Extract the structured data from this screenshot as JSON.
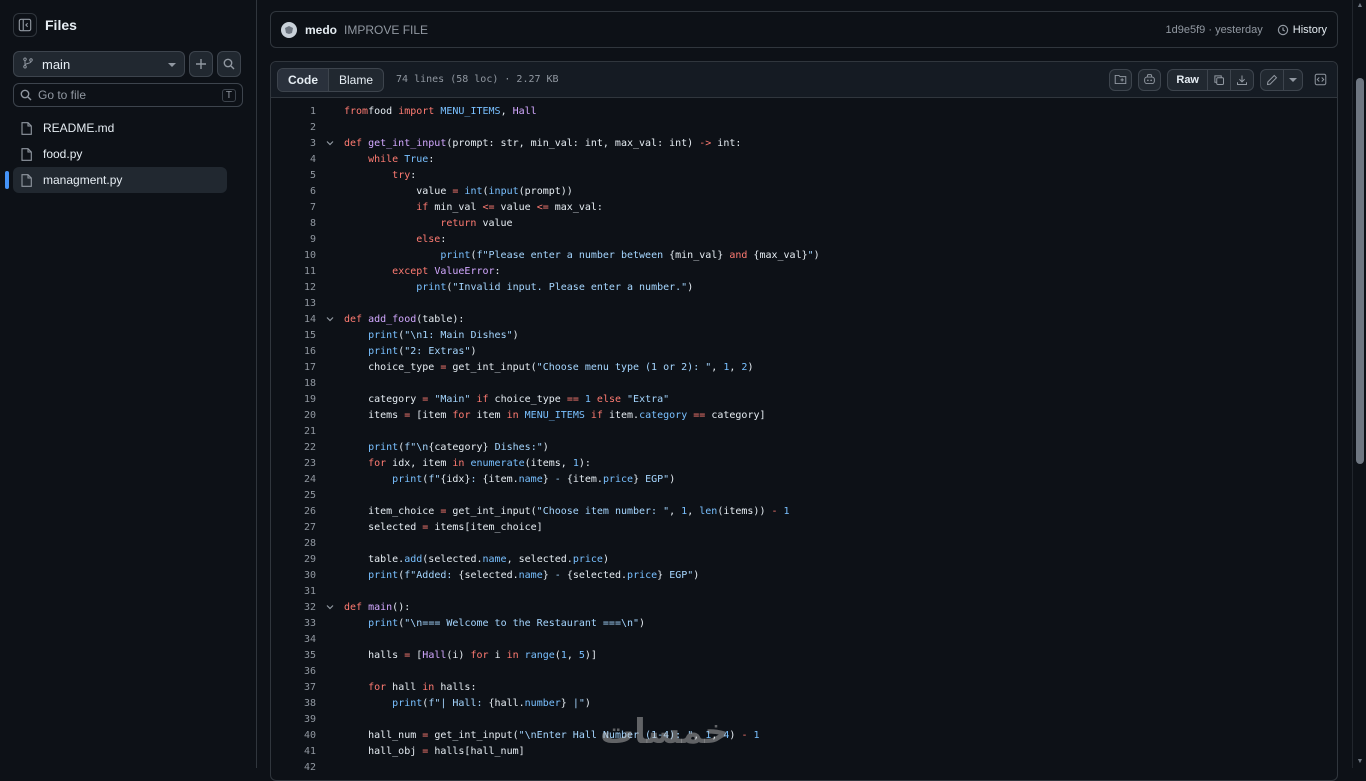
{
  "sidebar": {
    "title": "Files",
    "branch": "main",
    "search_placeholder": "Go to file",
    "search_shortcut": "T",
    "files": [
      {
        "name": "README.md",
        "active": false
      },
      {
        "name": "food.py",
        "active": false
      },
      {
        "name": "managment.py",
        "active": true
      }
    ]
  },
  "commit": {
    "author": "medo",
    "message": "IMPROVE FILE",
    "meta": "1d9e5f9 · yesterday",
    "history_label": "History"
  },
  "toolbar": {
    "code_tab": "Code",
    "blame_tab": "Blame",
    "file_info": "74 lines (58 loc) · 2.27 KB",
    "raw_label": "Raw"
  },
  "code_lines": [
    {
      "n": "1",
      "fold": false,
      "tokens": [
        [
          "k",
          "from"
        ],
        [
          "",
          "food "
        ],
        [
          "k",
          "import"
        ],
        [
          "c",
          " MENU_ITEMS"
        ],
        [
          "",
          ", "
        ],
        [
          "f",
          "Hall"
        ]
      ]
    },
    {
      "n": "2",
      "fold": false,
      "tokens": []
    },
    {
      "n": "3",
      "fold": true,
      "tokens": [
        [
          "k",
          "def"
        ],
        [
          "f",
          " get_int_input"
        ],
        [
          "",
          "(prompt: str, min_val: int, max_val: int) "
        ],
        [
          "o",
          "->"
        ],
        [
          "",
          " int:"
        ]
      ]
    },
    {
      "n": "4",
      "fold": false,
      "tokens": [
        [
          "",
          "    "
        ],
        [
          "k",
          "while"
        ],
        [
          "c",
          " True"
        ],
        [
          "",
          ":"
        ]
      ]
    },
    {
      "n": "5",
      "fold": false,
      "tokens": [
        [
          "",
          "        "
        ],
        [
          "k",
          "try"
        ],
        [
          "",
          ":"
        ]
      ]
    },
    {
      "n": "6",
      "fold": false,
      "tokens": [
        [
          "",
          "            value "
        ],
        [
          "o",
          "="
        ],
        [
          "c",
          " int"
        ],
        [
          "",
          "("
        ],
        [
          "c",
          "input"
        ],
        [
          "",
          "(prompt))"
        ]
      ]
    },
    {
      "n": "7",
      "fold": false,
      "tokens": [
        [
          "",
          "            "
        ],
        [
          "k",
          "if"
        ],
        [
          "",
          " min_val "
        ],
        [
          "o",
          "<="
        ],
        [
          "",
          " value "
        ],
        [
          "o",
          "<="
        ],
        [
          "",
          " max_val:"
        ]
      ]
    },
    {
      "n": "8",
      "fold": false,
      "tokens": [
        [
          "",
          "                "
        ],
        [
          "k",
          "return"
        ],
        [
          "",
          " value"
        ]
      ]
    },
    {
      "n": "9",
      "fold": false,
      "tokens": [
        [
          "",
          "            "
        ],
        [
          "k",
          "else"
        ],
        [
          "",
          ":"
        ]
      ]
    },
    {
      "n": "10",
      "fold": false,
      "tokens": [
        [
          "",
          "                "
        ],
        [
          "c",
          "print"
        ],
        [
          "",
          "("
        ],
        [
          "s",
          "f\"Please enter a number between "
        ],
        [
          "",
          "{min_val}"
        ],
        [
          "k",
          " and "
        ],
        [
          "",
          "{max_val}"
        ],
        [
          "s",
          "\""
        ],
        [
          "",
          ")"
        ]
      ]
    },
    {
      "n": "11",
      "fold": false,
      "tokens": [
        [
          "",
          "        "
        ],
        [
          "k",
          "except"
        ],
        [
          "f",
          " ValueError"
        ],
        [
          "",
          ":"
        ]
      ]
    },
    {
      "n": "12",
      "fold": false,
      "tokens": [
        [
          "",
          "            "
        ],
        [
          "c",
          "print"
        ],
        [
          "",
          "("
        ],
        [
          "s",
          "\"Invalid input. Please enter a number.\""
        ],
        [
          "",
          ")"
        ]
      ]
    },
    {
      "n": "13",
      "fold": false,
      "tokens": []
    },
    {
      "n": "14",
      "fold": true,
      "tokens": [
        [
          "k",
          "def"
        ],
        [
          "f",
          " add_food"
        ],
        [
          "",
          "(table):"
        ]
      ]
    },
    {
      "n": "15",
      "fold": false,
      "tokens": [
        [
          "",
          "    "
        ],
        [
          "c",
          "print"
        ],
        [
          "",
          "("
        ],
        [
          "s",
          "\"\\n1: Main Dishes\""
        ],
        [
          "",
          ")"
        ]
      ]
    },
    {
      "n": "16",
      "fold": false,
      "tokens": [
        [
          "",
          "    "
        ],
        [
          "c",
          "print"
        ],
        [
          "",
          "("
        ],
        [
          "s",
          "\"2: Extras\""
        ],
        [
          "",
          ")"
        ]
      ]
    },
    {
      "n": "17",
      "fold": false,
      "tokens": [
        [
          "",
          "    choice_type "
        ],
        [
          "o",
          "="
        ],
        [
          "",
          " get_int_input("
        ],
        [
          "s",
          "\"Choose menu type (1 or 2): \""
        ],
        [
          "",
          ", "
        ],
        [
          "c",
          "1"
        ],
        [
          "",
          ", "
        ],
        [
          "c",
          "2"
        ],
        [
          "",
          ")"
        ]
      ]
    },
    {
      "n": "18",
      "fold": false,
      "tokens": []
    },
    {
      "n": "19",
      "fold": false,
      "tokens": [
        [
          "",
          "    category "
        ],
        [
          "o",
          "="
        ],
        [
          "s",
          " \"Main\""
        ],
        [
          "k",
          " if"
        ],
        [
          "",
          " choice_type "
        ],
        [
          "o",
          "=="
        ],
        [
          "c",
          " 1"
        ],
        [
          "k",
          " else"
        ],
        [
          "s",
          " \"Extra\""
        ]
      ]
    },
    {
      "n": "20",
      "fold": false,
      "tokens": [
        [
          "",
          "    items "
        ],
        [
          "o",
          "="
        ],
        [
          "",
          " [item "
        ],
        [
          "k",
          "for"
        ],
        [
          "",
          " item "
        ],
        [
          "k",
          "in"
        ],
        [
          "c",
          " MENU_ITEMS"
        ],
        [
          "k",
          " if"
        ],
        [
          "",
          " item."
        ],
        [
          "c",
          "category"
        ],
        [
          "o",
          " =="
        ],
        [
          "",
          " category]"
        ]
      ]
    },
    {
      "n": "21",
      "fold": false,
      "tokens": []
    },
    {
      "n": "22",
      "fold": false,
      "tokens": [
        [
          "",
          "    "
        ],
        [
          "c",
          "print"
        ],
        [
          "",
          "("
        ],
        [
          "s",
          "f\"\\n"
        ],
        [
          "",
          "{category}"
        ],
        [
          "s",
          " Dishes:\""
        ],
        [
          "",
          ")"
        ]
      ]
    },
    {
      "n": "23",
      "fold": false,
      "tokens": [
        [
          "",
          "    "
        ],
        [
          "k",
          "for"
        ],
        [
          "",
          " idx, item "
        ],
        [
          "k",
          "in"
        ],
        [
          "c",
          " enumerate"
        ],
        [
          "",
          "(items, "
        ],
        [
          "c",
          "1"
        ],
        [
          "",
          "):"
        ]
      ]
    },
    {
      "n": "24",
      "fold": false,
      "tokens": [
        [
          "",
          "        "
        ],
        [
          "c",
          "print"
        ],
        [
          "",
          "("
        ],
        [
          "s",
          "f\""
        ],
        [
          "",
          "{idx}"
        ],
        [
          "s",
          ": "
        ],
        [
          "",
          "{item."
        ],
        [
          "c",
          "name"
        ],
        [
          "",
          "}"
        ],
        [
          "s",
          " - "
        ],
        [
          "",
          "{item."
        ],
        [
          "c",
          "price"
        ],
        [
          "",
          "}"
        ],
        [
          "s",
          " EGP\""
        ],
        [
          "",
          ")"
        ]
      ]
    },
    {
      "n": "25",
      "fold": false,
      "tokens": []
    },
    {
      "n": "26",
      "fold": false,
      "tokens": [
        [
          "",
          "    item_choice "
        ],
        [
          "o",
          "="
        ],
        [
          "",
          " get_int_input("
        ],
        [
          "s",
          "\"Choose item number: \""
        ],
        [
          "",
          ", "
        ],
        [
          "c",
          "1"
        ],
        [
          "",
          ", "
        ],
        [
          "c",
          "len"
        ],
        [
          "",
          "(items)) "
        ],
        [
          "o",
          "-"
        ],
        [
          "c",
          " 1"
        ]
      ]
    },
    {
      "n": "27",
      "fold": false,
      "tokens": [
        [
          "",
          "    selected "
        ],
        [
          "o",
          "="
        ],
        [
          "",
          " items[item_choice]"
        ]
      ]
    },
    {
      "n": "28",
      "fold": false,
      "tokens": []
    },
    {
      "n": "29",
      "fold": false,
      "tokens": [
        [
          "",
          "    table."
        ],
        [
          "c",
          "add"
        ],
        [
          "",
          "(selected."
        ],
        [
          "c",
          "name"
        ],
        [
          "",
          ", selected."
        ],
        [
          "c",
          "price"
        ],
        [
          "",
          ")"
        ]
      ]
    },
    {
      "n": "30",
      "fold": false,
      "tokens": [
        [
          "",
          "    "
        ],
        [
          "c",
          "print"
        ],
        [
          "",
          "("
        ],
        [
          "s",
          "f\"Added: "
        ],
        [
          "",
          "{selected."
        ],
        [
          "c",
          "name"
        ],
        [
          "",
          "}"
        ],
        [
          "s",
          " - "
        ],
        [
          "",
          "{selected."
        ],
        [
          "c",
          "price"
        ],
        [
          "",
          "}"
        ],
        [
          "s",
          " EGP\""
        ],
        [
          "",
          ")"
        ]
      ]
    },
    {
      "n": "31",
      "fold": false,
      "tokens": []
    },
    {
      "n": "32",
      "fold": true,
      "tokens": [
        [
          "k",
          "def"
        ],
        [
          "f",
          " main"
        ],
        [
          "",
          "():"
        ]
      ]
    },
    {
      "n": "33",
      "fold": false,
      "tokens": [
        [
          "",
          "    "
        ],
        [
          "c",
          "print"
        ],
        [
          "",
          "("
        ],
        [
          "s",
          "\"\\n=== Welcome to the Restaurant ===\\n\""
        ],
        [
          "",
          ")"
        ]
      ]
    },
    {
      "n": "34",
      "fold": false,
      "tokens": []
    },
    {
      "n": "35",
      "fold": false,
      "tokens": [
        [
          "",
          "    halls "
        ],
        [
          "o",
          "="
        ],
        [
          "",
          " ["
        ],
        [
          "f",
          "Hall"
        ],
        [
          "",
          "(i) "
        ],
        [
          "k",
          "for"
        ],
        [
          "",
          " i "
        ],
        [
          "k",
          "in"
        ],
        [
          "c",
          " range"
        ],
        [
          "",
          "("
        ],
        [
          "c",
          "1"
        ],
        [
          "",
          ", "
        ],
        [
          "c",
          "5"
        ],
        [
          "",
          ")]"
        ]
      ]
    },
    {
      "n": "36",
      "fold": false,
      "tokens": []
    },
    {
      "n": "37",
      "fold": false,
      "tokens": [
        [
          "",
          "    "
        ],
        [
          "k",
          "for"
        ],
        [
          "",
          " hall "
        ],
        [
          "k",
          "in"
        ],
        [
          "",
          " halls:"
        ]
      ]
    },
    {
      "n": "38",
      "fold": false,
      "tokens": [
        [
          "",
          "        "
        ],
        [
          "c",
          "print"
        ],
        [
          "",
          "("
        ],
        [
          "s",
          "f\"| Hall: "
        ],
        [
          "",
          "{hall."
        ],
        [
          "c",
          "number"
        ],
        [
          "",
          "}"
        ],
        [
          "s",
          " |\""
        ],
        [
          "",
          ")"
        ]
      ]
    },
    {
      "n": "39",
      "fold": false,
      "tokens": []
    },
    {
      "n": "40",
      "fold": false,
      "tokens": [
        [
          "",
          "    hall_num "
        ],
        [
          "o",
          "="
        ],
        [
          "",
          " get_int_input("
        ],
        [
          "s",
          "\"\\nEnter Hall Number (1-4): \""
        ],
        [
          "",
          ", "
        ],
        [
          "c",
          "1"
        ],
        [
          "",
          ", "
        ],
        [
          "c",
          "4"
        ],
        [
          "",
          ") "
        ],
        [
          "o",
          "-"
        ],
        [
          "c",
          " 1"
        ]
      ]
    },
    {
      "n": "41",
      "fold": false,
      "tokens": [
        [
          "",
          "    hall_obj "
        ],
        [
          "o",
          "="
        ],
        [
          "",
          " halls[hall_num]"
        ]
      ]
    },
    {
      "n": "42",
      "fold": false,
      "tokens": []
    }
  ],
  "watermark": "خمسات",
  "colors": {
    "accent": "#4493f8",
    "keyword": "#ff7b72",
    "function": "#d2a8ff",
    "string": "#a5d6ff",
    "constant": "#79c0ff"
  }
}
